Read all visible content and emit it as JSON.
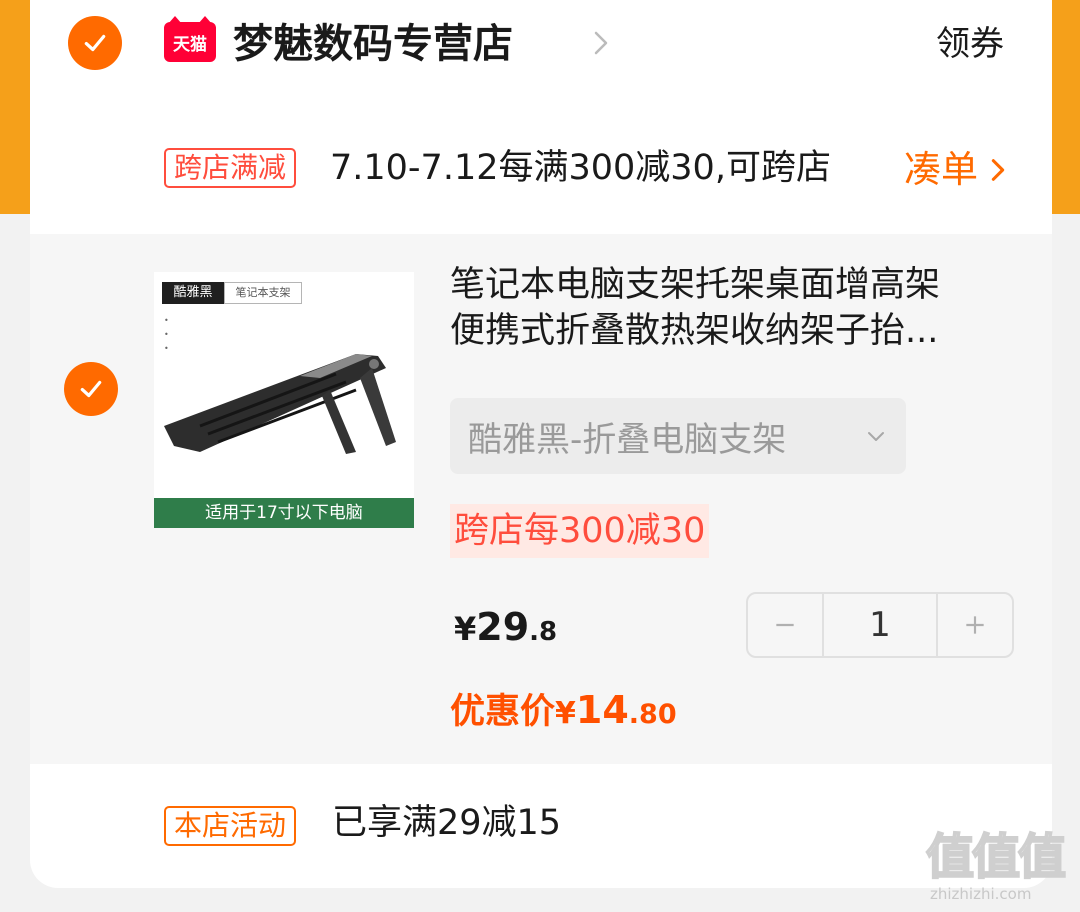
{
  "colors": {
    "accent": "#ff6a00",
    "tag_red": "#ff4d3d",
    "tmall_red": "#ff0036",
    "strip_orange": "#f5a01a"
  },
  "store": {
    "platform_logo": "天猫",
    "name": "梦魅数码专营店",
    "coupon_label": "领券",
    "checked": true
  },
  "promotion": {
    "tag": "跨店满减",
    "text": "7.10-7.12每满300减30,可跨店",
    "action_label": "凑单"
  },
  "item": {
    "checked": true,
    "thumbnail": {
      "badge_dark": "酷雅黑",
      "badge_light": "笔记本支架",
      "caption": "适用于17寸以下电脑"
    },
    "title_line1": "笔记本电脑支架托架桌面增高架",
    "title_line2": "便携式折叠散热架收纳架子抬...",
    "sku": "酷雅黑-折叠电脑支架",
    "promo_tag": "跨店每300减30",
    "price": {
      "symbol": "¥",
      "integer": "29",
      "decimal": ".8"
    },
    "quantity": "1",
    "discount": {
      "label": "优惠价",
      "symbol": "¥",
      "integer": "14",
      "decimal": ".80"
    }
  },
  "shop_activity": {
    "tag": "本店活动",
    "text": "已享满29减15"
  },
  "watermark": {
    "glyphs": "值值值",
    "url": "zhizhizhi.com"
  }
}
